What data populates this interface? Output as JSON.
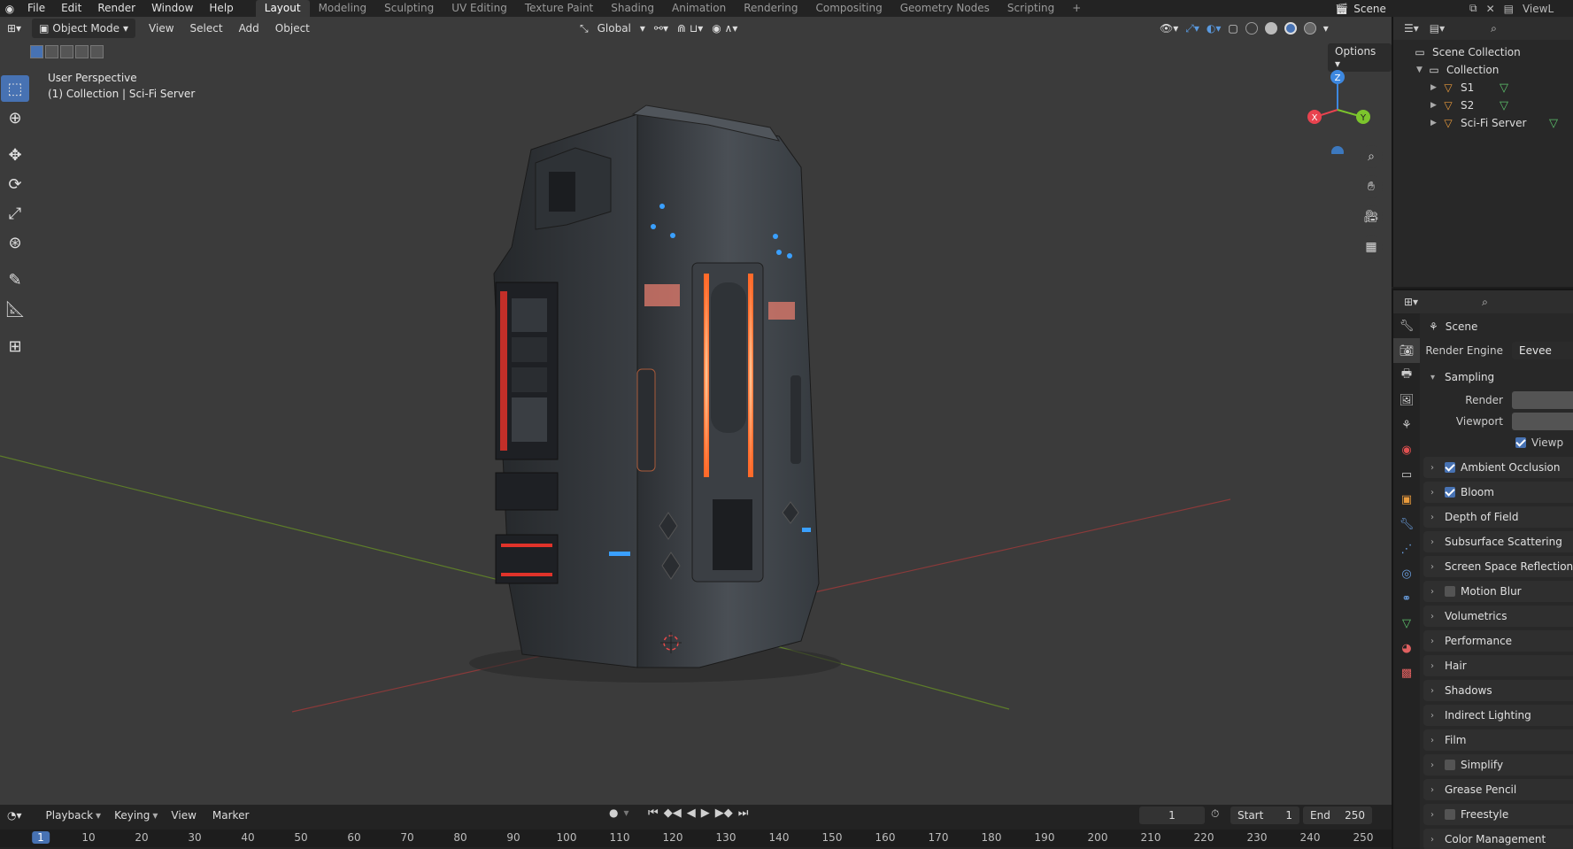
{
  "topbar": {
    "menus": [
      "File",
      "Edit",
      "Render",
      "Window",
      "Help"
    ],
    "workspaces": [
      "Layout",
      "Modeling",
      "Sculpting",
      "UV Editing",
      "Texture Paint",
      "Shading",
      "Animation",
      "Rendering",
      "Compositing",
      "Geometry Nodes",
      "Scripting"
    ],
    "add_tab": "+",
    "scene_name": "Scene",
    "view_layer": "ViewL"
  },
  "viewport": {
    "mode": "Object Mode",
    "menus": [
      "View",
      "Select",
      "Add",
      "Object"
    ],
    "transform_orientation": "Global",
    "options_label": "Options",
    "info_line1": "User Perspective",
    "info_line2": "(1) Collection | Sci-Fi Server",
    "gizmo": {
      "x": "X",
      "y": "Y",
      "z": "Z"
    }
  },
  "outliner": {
    "scene_collection": "Scene Collection",
    "collection": "Collection",
    "objects": [
      "S1",
      "S2",
      "Sci-Fi Server"
    ]
  },
  "properties": {
    "context": "Scene",
    "render_engine_label": "Render Engine",
    "render_engine_value": "Eevee",
    "sampling_label": "Sampling",
    "render_label": "Render",
    "viewport_label": "Viewport",
    "viewport_denoise": "Viewp",
    "panels": [
      {
        "label": "Ambient Occlusion",
        "checkbox": true,
        "checked": true
      },
      {
        "label": "Bloom",
        "checkbox": true,
        "checked": true
      },
      {
        "label": "Depth of Field",
        "checkbox": false,
        "checked": false
      },
      {
        "label": "Subsurface Scattering",
        "checkbox": false,
        "checked": false
      },
      {
        "label": "Screen Space Reflections",
        "checkbox": true,
        "checked": false
      },
      {
        "label": "Motion Blur",
        "checkbox": true,
        "checked": false
      },
      {
        "label": "Volumetrics",
        "checkbox": false,
        "checked": false
      },
      {
        "label": "Performance",
        "checkbox": false,
        "checked": false
      },
      {
        "label": "Hair",
        "checkbox": false,
        "checked": false
      },
      {
        "label": "Shadows",
        "checkbox": false,
        "checked": false
      },
      {
        "label": "Indirect Lighting",
        "checkbox": false,
        "checked": false
      },
      {
        "label": "Film",
        "checkbox": false,
        "checked": false
      },
      {
        "label": "Simplify",
        "checkbox": true,
        "checked": false
      },
      {
        "label": "Grease Pencil",
        "checkbox": false,
        "checked": false
      },
      {
        "label": "Freestyle",
        "checkbox": true,
        "checked": false
      },
      {
        "label": "Color Management",
        "checkbox": false,
        "checked": false
      }
    ]
  },
  "timeline": {
    "menus": [
      "Playback",
      "Keying",
      "View",
      "Marker"
    ],
    "current_frame": "1",
    "start_label": "Start",
    "start_value": "1",
    "end_label": "End",
    "end_value": "250",
    "ruler": [
      "1",
      "10",
      "20",
      "30",
      "40",
      "50",
      "60",
      "70",
      "80",
      "90",
      "100",
      "110",
      "120",
      "130",
      "140",
      "150",
      "160",
      "170",
      "180",
      "190",
      "200",
      "210",
      "220",
      "230",
      "240",
      "250"
    ]
  },
  "colors": {
    "accent": "#4772b3",
    "glow": "#ff8a4c",
    "blue_light": "#3aa0ff",
    "axis_x": "#e8434f",
    "axis_y": "#7cc52c",
    "axis_z": "#3d88e0"
  }
}
